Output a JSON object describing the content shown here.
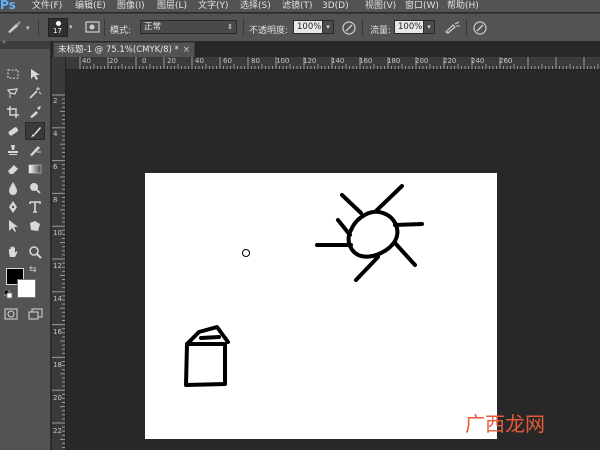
{
  "app": {
    "logo": "Ps"
  },
  "menu": [
    "文件(F)",
    "编辑(E)",
    "图像(I)",
    "图层(L)",
    "文字(Y)",
    "选择(S)",
    "滤镜(T)",
    "3D(D)",
    "视图(V)",
    "窗口(W)",
    "帮助(H)"
  ],
  "options": {
    "brush_size": "17",
    "mode_label": "模式:",
    "mode_value": "正常",
    "opacity_label": "不透明度:",
    "opacity_value": "100%",
    "flow_label": "流量:",
    "flow_value": "100%"
  },
  "document": {
    "tab_title": "未标题-1 @ 75.1%(CMYK/8) *",
    "close_glyph": "×"
  },
  "ruler": {
    "h_ticks": [
      "40",
      "20",
      "0",
      "20",
      "40",
      "60",
      "80",
      "100",
      "120",
      "140",
      "160",
      "180",
      "200",
      "220",
      "240",
      "260"
    ],
    "v_ticks": [
      "2",
      "4",
      "6",
      "8",
      "10",
      "12",
      "14",
      "16",
      "18",
      "20",
      "22"
    ]
  },
  "colors": {
    "foreground": "#000000",
    "background": "#ffffff",
    "ui_panel": "#535353",
    "workspace": "#282828"
  },
  "tools": [
    "move-tool-icon",
    "marquee-tool-icon",
    "lasso-tool-icon",
    "magic-wand-icon",
    "crop-tool-icon",
    "eyedropper-icon",
    "healing-brush-icon",
    "brush-tool-icon",
    "clone-stamp-icon",
    "history-brush-icon",
    "eraser-icon",
    "gradient-icon",
    "blur-icon",
    "dodge-icon",
    "pen-tool-icon",
    "type-tool-icon",
    "path-select-icon",
    "shape-tool-icon",
    "hand-tool-icon",
    "zoom-tool-icon"
  ],
  "watermark": "广西龙网"
}
